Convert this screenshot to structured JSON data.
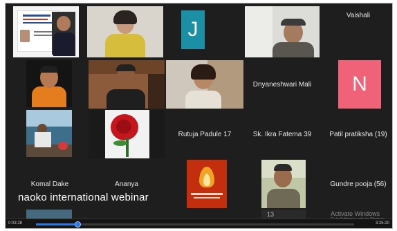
{
  "video": {
    "caption": "naoko international webinar",
    "current_time": "0:03:28",
    "total_time": "3:25:20",
    "progress": 0.13
  },
  "participants": [
    {
      "name": "Vaishali"
    },
    {
      "name": "Dnyaneshwari Mali"
    },
    {
      "name": "Rutuja Padule 17"
    },
    {
      "name": "Sk. Ikra Fatema 39"
    },
    {
      "name": "Patil pratiksha (19)"
    },
    {
      "name": "Komal Dake"
    },
    {
      "name": "Ananya"
    },
    {
      "name": "Gundre pooja (56)"
    }
  ],
  "avatars": [
    {
      "letter": "J",
      "color": "#1a8fa6"
    },
    {
      "letter": "N",
      "color": "#f06278"
    }
  ],
  "watermark": {
    "line1": "Activate Windows",
    "line2": "Go to Settings to activate Windows."
  },
  "bottom_partial_text": "13"
}
